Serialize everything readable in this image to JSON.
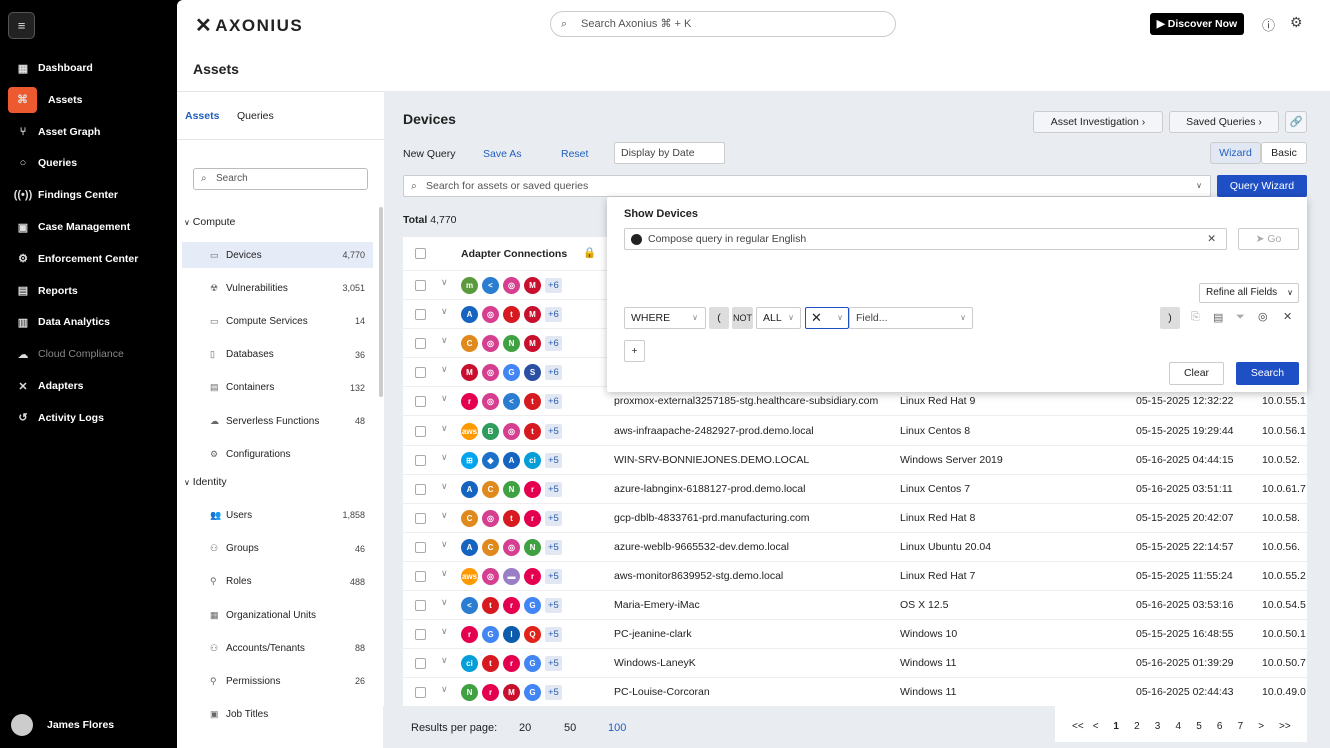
{
  "sidebar": {
    "items": [
      {
        "label": "Dashboard",
        "icon": "▦"
      },
      {
        "label": "Assets",
        "icon": "⌘"
      },
      {
        "label": "Asset Graph",
        "icon": "⑂"
      },
      {
        "label": "Queries",
        "icon": "○"
      },
      {
        "label": "Findings Center",
        "icon": "((•))"
      },
      {
        "label": "Case Management",
        "icon": "▣"
      },
      {
        "label": "Enforcement Center",
        "icon": "⚙"
      },
      {
        "label": "Reports",
        "icon": "▤"
      },
      {
        "label": "Data Analytics",
        "icon": "▥"
      },
      {
        "label": "Cloud Compliance",
        "icon": "☁"
      },
      {
        "label": "Adapters",
        "icon": "✕"
      },
      {
        "label": "Activity Logs",
        "icon": "↺"
      }
    ],
    "user": "James Flores"
  },
  "header": {
    "logo": "AXONIUS",
    "search_placeholder": "Search Axonius ⌘ + K",
    "discover": "▶ Discover Now",
    "page_title": "Assets"
  },
  "subnav": {
    "tabs": [
      "Assets",
      "Queries"
    ],
    "search_placeholder": "Search",
    "groups": [
      {
        "label": "Compute",
        "items": [
          {
            "label": "Devices",
            "count": "4,770",
            "icon": "▭"
          },
          {
            "label": "Vulnerabilities",
            "count": "3,051",
            "icon": "☢"
          },
          {
            "label": "Compute Services",
            "count": "14",
            "icon": "▭"
          },
          {
            "label": "Databases",
            "count": "36",
            "icon": "▯"
          },
          {
            "label": "Containers",
            "count": "132",
            "icon": "▤"
          },
          {
            "label": "Serverless Functions",
            "count": "48",
            "icon": "☁"
          },
          {
            "label": "Configurations",
            "count": "",
            "icon": "⚙"
          }
        ]
      },
      {
        "label": "Identity",
        "items": [
          {
            "label": "Users",
            "count": "1,858",
            "icon": "👥"
          },
          {
            "label": "Groups",
            "count": "46",
            "icon": "⚇"
          },
          {
            "label": "Roles",
            "count": "488",
            "icon": "⚲"
          },
          {
            "label": "Organizational Units",
            "count": "",
            "icon": "▦"
          },
          {
            "label": "Accounts/Tenants",
            "count": "88",
            "icon": "⚇"
          },
          {
            "label": "Permissions",
            "count": "26",
            "icon": "⚲"
          },
          {
            "label": "Job Titles",
            "count": "",
            "icon": "▣"
          }
        ]
      }
    ]
  },
  "main": {
    "title": "Devices",
    "asset_investigation": "Asset Investigation ›",
    "saved_queries": "Saved Queries ›",
    "new_query": "New Query",
    "save_as": "Save As",
    "reset": "Reset",
    "display_by_date": "Display by Date",
    "wizard": "Wizard",
    "basic": "Basic",
    "query_placeholder": "Search for assets or saved queries",
    "query_wizard": "Query Wizard",
    "total_label": "Total",
    "total": "4,770",
    "col_adapters": "Adapter Connections"
  },
  "popup": {
    "title": "Show Devices",
    "compose_placeholder": "Compose query in regular English",
    "go": "Go",
    "refine": "Refine all Fields",
    "where": "WHERE",
    "open_paren": "(",
    "not": "NOT",
    "all": "ALL",
    "field_placeholder": "Field...",
    "close_paren": ")",
    "add": "+",
    "clear": "Clear",
    "search": "Search"
  },
  "rows": [
    {
      "ads": [
        "meraki",
        "vscode",
        "pink",
        "mcafee"
      ],
      "count": "+6",
      "name": "",
      "os": "",
      "date": "",
      "ip": ""
    },
    {
      "ads": [
        "azure",
        "pink",
        "trend",
        "mcafee"
      ],
      "count": "+6",
      "name": "",
      "os": "",
      "date": "",
      "ip": ""
    },
    {
      "ads": [
        "chef",
        "pink",
        "nginx",
        "mcafee"
      ],
      "count": "+6",
      "name": "",
      "os": "",
      "date": "",
      "ip": ""
    },
    {
      "ads": [
        "mcafee",
        "pink",
        "google",
        "shield"
      ],
      "count": "+6",
      "name": "",
      "os": "",
      "date": "",
      "ip": ""
    },
    {
      "ads": [
        "rapid",
        "pink",
        "vscode",
        "trend"
      ],
      "count": "+6",
      "name": "proxmox-external3257185-stg.healthcare-subsidiary.com",
      "os": "Linux Red Hat 9",
      "date": "05-15-2025 12:32:22",
      "ip": "10.0.55.1"
    },
    {
      "ads": [
        "aws",
        "b",
        "pink",
        "trend"
      ],
      "count": "+5",
      "name": "aws-infraapache-2482927-prod.demo.local",
      "os": "Linux Centos 8",
      "date": "05-15-2025 19:29:44",
      "ip": "10.0.56.1"
    },
    {
      "ads": [
        "windows",
        "drop",
        "azure",
        "cisco"
      ],
      "count": "+5",
      "name": "WIN-SRV-BONNIEJONES.DEMO.LOCAL",
      "os": "Windows Server 2019",
      "date": "05-16-2025 04:44:15",
      "ip": "10.0.52."
    },
    {
      "ads": [
        "azure",
        "chef",
        "nginx",
        "rapid"
      ],
      "count": "+5",
      "name": "azure-labnginx-6188127-prod.demo.local",
      "os": "Linux Centos 7",
      "date": "05-16-2025 03:51:11",
      "ip": "10.0.61.7"
    },
    {
      "ads": [
        "chef",
        "pink",
        "trend",
        "rapid"
      ],
      "count": "+5",
      "name": "gcp-dblb-4833761-prd.manufacturing.com",
      "os": "Linux Red Hat 8",
      "date": "05-15-2025 20:42:07",
      "ip": "10.0.58."
    },
    {
      "ads": [
        "azure",
        "chef",
        "pink",
        "nginx"
      ],
      "count": "+5",
      "name": "azure-weblb-9665532-dev.demo.local",
      "os": "Linux Ubuntu 20.04",
      "date": "05-15-2025 22:14:57",
      "ip": "10.0.56."
    },
    {
      "ads": [
        "aws",
        "pink",
        "lock",
        "rapid"
      ],
      "count": "+5",
      "name": "aws-monitor8639952-stg.demo.local",
      "os": "Linux Red Hat 7",
      "date": "05-15-2025 11:55:24",
      "ip": "10.0.55.2"
    },
    {
      "ads": [
        "vscode",
        "trend",
        "rapid",
        "google"
      ],
      "count": "+5",
      "name": "Maria-Emery-iMac",
      "os": "OS X 12.5",
      "date": "05-16-2025 03:53:16",
      "ip": "10.0.54.5"
    },
    {
      "ads": [
        "rapid",
        "google",
        "intune",
        "qualys"
      ],
      "count": "+5",
      "name": "PC-jeanine-clark",
      "os": "Windows 10",
      "date": "05-15-2025 16:48:55",
      "ip": "10.0.50.1"
    },
    {
      "ads": [
        "cisco",
        "trend",
        "rapid",
        "google"
      ],
      "count": "+5",
      "name": "Windows-LaneyK",
      "os": "Windows 11",
      "date": "05-16-2025 01:39:29",
      "ip": "10.0.50.7"
    },
    {
      "ads": [
        "nginx",
        "rapid",
        "mcafee",
        "google"
      ],
      "count": "+5",
      "name": "PC-Louise-Corcoran",
      "os": "Windows 11",
      "date": "05-16-2025 02:44:43",
      "ip": "10.0.49.0"
    }
  ],
  "pagination": {
    "label": "Results per page:",
    "sizes": [
      "20",
      "50",
      "100"
    ],
    "pages": [
      "<<",
      "<",
      "1",
      "2",
      "3",
      "4",
      "5",
      "6",
      "7",
      ">",
      ">>"
    ]
  }
}
